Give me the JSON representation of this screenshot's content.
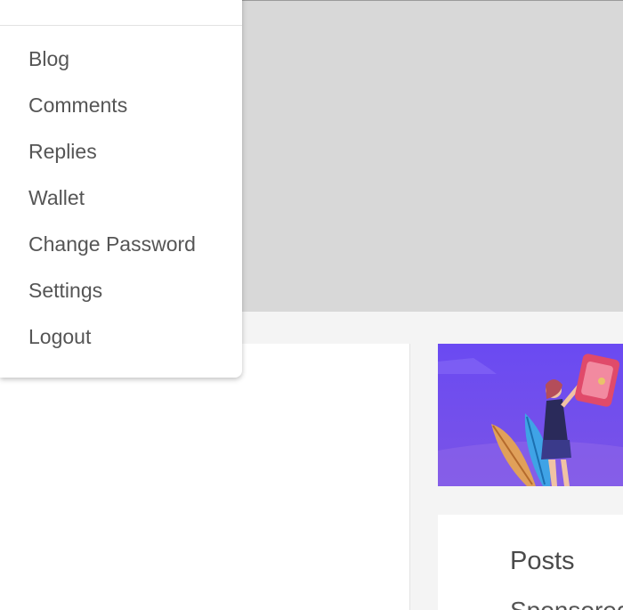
{
  "menu": {
    "items": [
      {
        "label": "Blog"
      },
      {
        "label": "Comments"
      },
      {
        "label": "Replies"
      },
      {
        "label": "Wallet"
      },
      {
        "label": "Change Password"
      },
      {
        "label": "Settings"
      },
      {
        "label": "Logout"
      }
    ]
  },
  "posts_card": {
    "title": "Posts",
    "subtitle": "Sponsored"
  },
  "colors": {
    "hero_bg": "#d8d8d8",
    "page_bg": "#f4f4f4",
    "banner_purple": "#6d4bf0",
    "menu_text": "#555555"
  }
}
